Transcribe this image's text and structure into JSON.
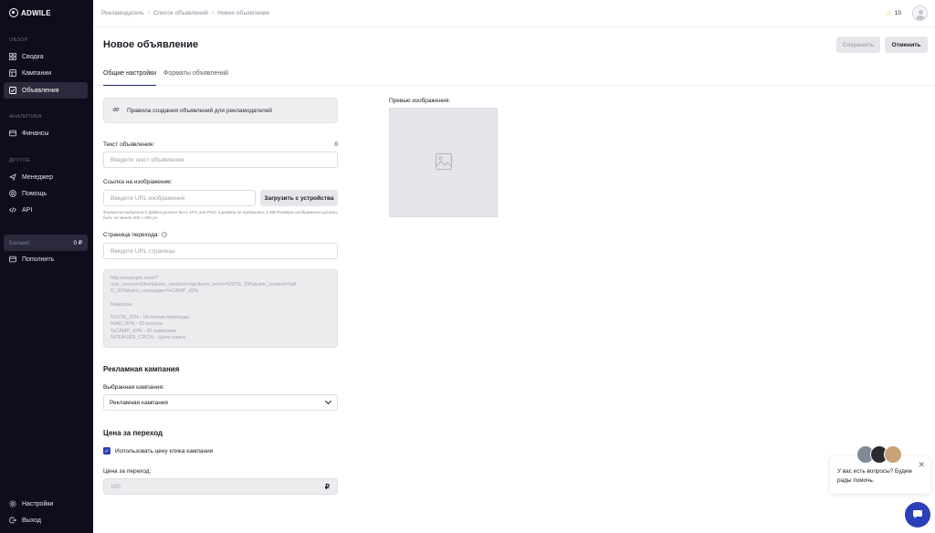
{
  "brand": {
    "name": "ADWILE"
  },
  "sidebar": {
    "sections": {
      "overview": "ОБЗОР",
      "analytics": "АНАЛИТИКА",
      "other": "ДРУГОЕ"
    },
    "items": [
      {
        "label": "Сводка",
        "icon": "grid-icon"
      },
      {
        "label": "Кампании",
        "icon": "campaign-icon"
      },
      {
        "label": "Объявления",
        "icon": "ads-icon",
        "active": true
      },
      {
        "label": "Финансы",
        "icon": "wallet-icon"
      },
      {
        "label": "Менеджер",
        "icon": "manager-icon"
      },
      {
        "label": "Помощь",
        "icon": "help-icon"
      },
      {
        "label": "API",
        "icon": "code-icon"
      },
      {
        "label": "Пополнить",
        "icon": "wallet-icon"
      },
      {
        "label": "Настройки",
        "icon": "gear-icon"
      },
      {
        "label": "Выход",
        "icon": "logout-icon"
      }
    ],
    "balance": {
      "label": "Баланс:",
      "value": "0 ₽"
    }
  },
  "topbar": {
    "breadcrumbs": [
      "Рекламодатель",
      "Список объявлений",
      "Новое объявление"
    ],
    "stars": "10"
  },
  "header": {
    "title": "Новое объявление",
    "save_label": "Сохранить",
    "cancel_label": "Отменить"
  },
  "tabs": [
    {
      "label": "Общие настройки",
      "active": true
    },
    {
      "label": "Форматы объявлений",
      "active": false
    }
  ],
  "form": {
    "rules_link": "Правила создания объявлений для рекламодателей",
    "ad_text": {
      "label": "Текст объявления:",
      "counter": "0",
      "placeholder": "Введите текст объявления"
    },
    "image_url": {
      "label": "Ссылка на изображение:",
      "placeholder": "Введите URL изображения",
      "upload_label": "Загрузить с устройства",
      "hint": "Форматом выбранного файла должен быть JPG или PNG, а размер не превышать 1 МБ.Размеры изображения должны быть не менее 400 x 400 px."
    },
    "landing": {
      "label": "Страница перехода:",
      "placeholder": "Введите URL страницы",
      "macros_lines": [
        "http://example.com/?",
        "utm_source=24smi&utm_medium=cpc&utm_term=%SITE_ID%&utm_content=%A",
        "D_ID%&utm_campaign=%CAMP_ID%",
        "",
        "Макросы:",
        "",
        "%SITE_ID% - Источник перехода",
        "%AD_ID% - ID анонса",
        "%CAMP_ID% - ID кампании",
        "%TEASER_CPC% - Цена клика"
      ]
    },
    "campaign": {
      "section_title": "Рекламная кампания",
      "label": "Выбранная кампания:",
      "selected": "Рекламная кампания"
    },
    "price": {
      "section_title": "Цена за переход",
      "checkbox_label": "Использовать цену клика кампании",
      "checkbox_checked": true,
      "label": "Цена за переход:",
      "value": "100",
      "currency": "₽"
    }
  },
  "preview": {
    "label": "Превью изображения:"
  },
  "chat": {
    "message": "У вас есть вопросы? Будем рады помочь."
  },
  "colors": {
    "accent": "#2b3fb8",
    "sidebar_bg": "#0d0d1c"
  }
}
